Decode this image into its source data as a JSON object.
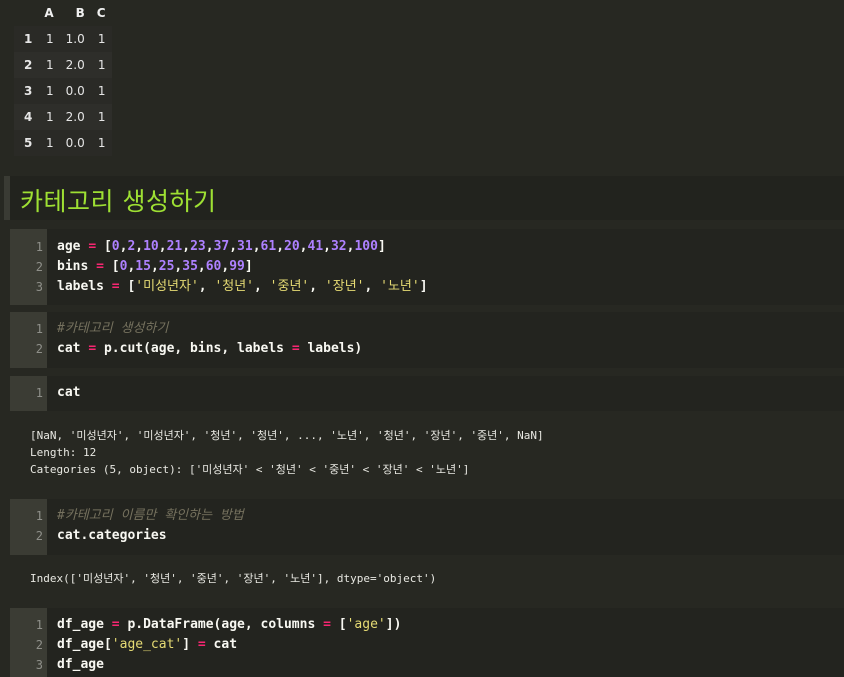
{
  "dataframe": {
    "columns": [
      "A",
      "B",
      "C"
    ],
    "rows": [
      {
        "index": "1",
        "A": "1",
        "B": "1.0",
        "C": "1"
      },
      {
        "index": "2",
        "A": "1",
        "B": "2.0",
        "C": "1"
      },
      {
        "index": "3",
        "A": "1",
        "B": "0.0",
        "C": "1"
      },
      {
        "index": "4",
        "A": "1",
        "B": "2.0",
        "C": "1"
      },
      {
        "index": "5",
        "A": "1",
        "B": "0.0",
        "C": "1"
      }
    ]
  },
  "heading": "카테고리 생성하기",
  "cells": [
    {
      "line_numbers": [
        "1",
        "2",
        "3"
      ]
    },
    {
      "line_numbers": [
        "1",
        "2"
      ]
    },
    {
      "line_numbers": [
        "1"
      ]
    },
    {
      "line_numbers": [
        "1",
        "2"
      ]
    },
    {
      "line_numbers": [
        "1",
        "2",
        "3"
      ]
    }
  ],
  "code": {
    "c1": {
      "age_var": "age",
      "age_eq": " = ",
      "age_nums": [
        "0",
        "2",
        "10",
        "21",
        "23",
        "37",
        "31",
        "61",
        "20",
        "41",
        "32",
        "100"
      ],
      "bins_var": "bins",
      "bins_eq": " = ",
      "bins_nums": [
        "0",
        "15",
        "25",
        "35",
        "60",
        "99"
      ],
      "labels_var": "labels",
      "labels_eq": " = ",
      "labels_strs": [
        "'미성년자'",
        "'청년'",
        "'중년'",
        "'장년'",
        "'노년'"
      ]
    },
    "c2": {
      "comment": "#카테고리 생성하기",
      "line2_a": "cat ",
      "line2_eq1": "=",
      "line2_b": " p.cut(age, bins, labels ",
      "line2_eq2": "=",
      "line2_c": " labels)"
    },
    "c3": {
      "line1": "cat"
    },
    "c4": {
      "comment": "#카테고리 이름만 확인하는 방법",
      "line2": "cat.categories"
    },
    "c5": {
      "l1_a": "df_age ",
      "l1_eq": "=",
      "l1_b": " p.DataFrame(age, columns ",
      "l1_eq2": "=",
      "l1_c": " [",
      "l1_str": "'age'",
      "l1_d": "])",
      "l2_a": "df_age[",
      "l2_str": "'age_cat'",
      "l2_b": "] ",
      "l2_eq": "=",
      "l2_c": " cat",
      "l3": "df_age"
    }
  },
  "outputs": {
    "cat": [
      "[NaN, '미성년자', '미성년자', '청년', '청년', ..., '노년', '청년', '장년', '중년', NaN]",
      "Length: 12",
      "Categories (5, object): ['미성년자' < '청년' < '중년' < '장년' < '노년']"
    ],
    "categories": [
      "Index(['미성년자', '청년', '중년', '장년', '노년'], dtype='object')"
    ]
  },
  "colors": {
    "background": "#272822",
    "heading": "#9ee033",
    "number": "#ae81ff",
    "string": "#e6db74",
    "operator": "#f92672",
    "comment": "#75715e"
  }
}
